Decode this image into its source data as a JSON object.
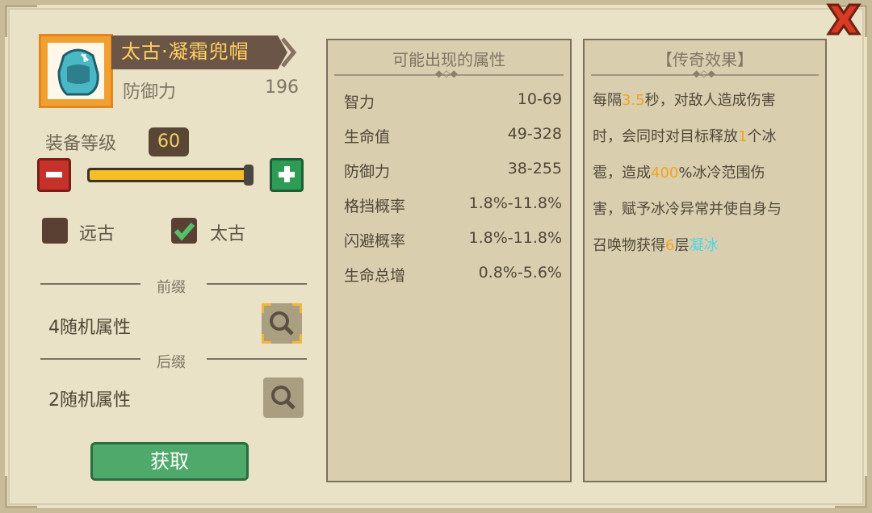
{
  "item": {
    "name": "太古·凝霜兜帽",
    "main_stat_label": "防御力",
    "main_stat_value": "196"
  },
  "level": {
    "label": "装备等级",
    "value": "60",
    "progress": 1.0
  },
  "rarity_options": [
    {
      "label": "远古",
      "checked": false
    },
    {
      "label": "太古",
      "checked": true
    }
  ],
  "prefix": {
    "title": "前缀",
    "text": "4随机属性"
  },
  "suffix": {
    "title": "后缀",
    "text": "2随机属性"
  },
  "get_button_label": "获取",
  "possible_attributes": {
    "title": "可能出现的属性",
    "rows": [
      {
        "name": "智力",
        "range": "10-69"
      },
      {
        "name": "生命值",
        "range": "49-328"
      },
      {
        "name": "防御力",
        "range": "38-255"
      },
      {
        "name": "格挡概率",
        "range": "1.8%-11.8%"
      },
      {
        "name": "闪避概率",
        "range": "1.8%-11.8%"
      },
      {
        "name": "生命总增",
        "range": "0.8%-5.6%"
      }
    ]
  },
  "legend": {
    "title": "【传奇效果】",
    "lines": [
      [
        "每隔",
        "3.5",
        "秒，对敌人造成伤害"
      ],
      [
        "时，会同时对目标释放",
        "1",
        "个冰"
      ],
      [
        "雹，造成",
        "400",
        "%冰冷范围伤"
      ],
      [
        "害，赋予冰冷异常并使自身与"
      ],
      [
        "召唤物获得",
        "6",
        "层",
        "凝冰"
      ]
    ]
  },
  "colors": {
    "highlight_orange": "#f1a31f",
    "highlight_cyan": "#4cd5e6",
    "name_gold": "#ffd060"
  }
}
